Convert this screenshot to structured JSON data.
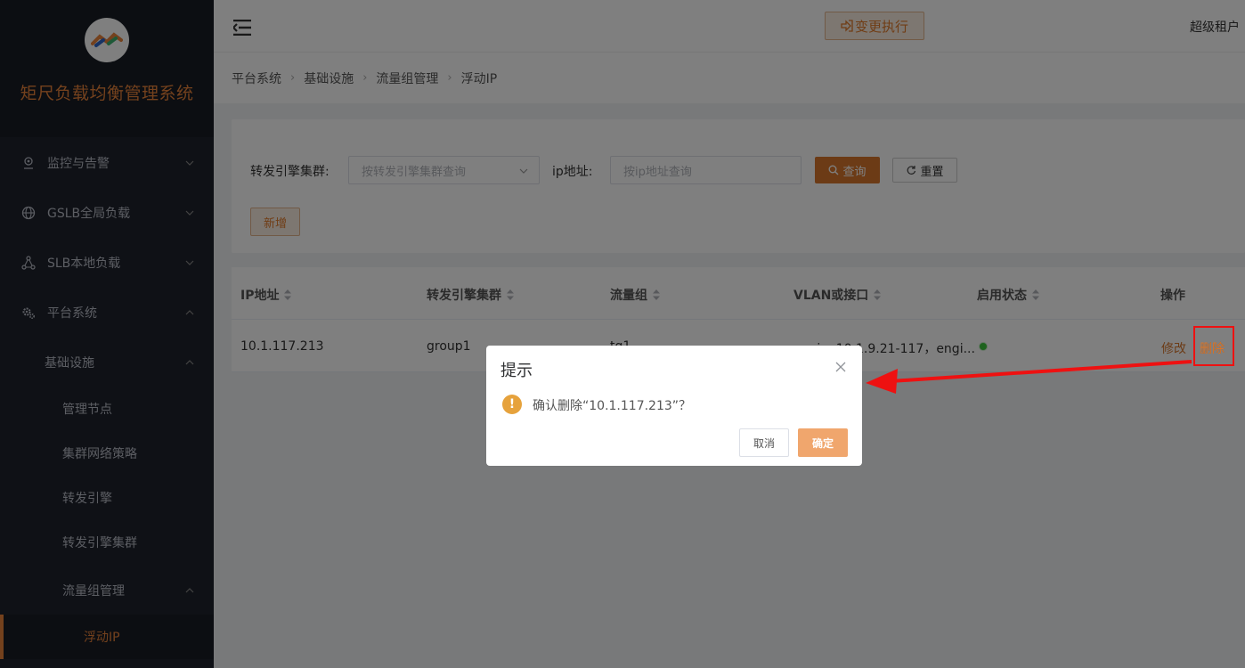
{
  "app": {
    "title": "矩尺负载均衡管理系统"
  },
  "sidebar": {
    "items": [
      {
        "label": "监控与告警",
        "icon": "location-pin-icon"
      },
      {
        "label": "GSLB全局负载",
        "icon": "globe-icon"
      },
      {
        "label": "SLB本地负载",
        "icon": "network-nodes-icon"
      },
      {
        "label": "平台系统",
        "icon": "gears-icon"
      }
    ],
    "sub_group": "基础设施",
    "sub_items": [
      "管理节点",
      "集群网络策略",
      "转发引擎",
      "转发引擎集群"
    ],
    "flow_group": "流量组管理",
    "active_item": "浮动IP"
  },
  "header": {
    "change_button": "变更执行",
    "user": "超级租户"
  },
  "breadcrumb": [
    "平台系统",
    "基础设施",
    "流量组管理",
    "浮动IP"
  ],
  "search": {
    "cluster_label": "转发引擎集群:",
    "cluster_placeholder": "按转发引擎集群查询",
    "ip_label": "ip地址:",
    "ip_placeholder": "按ip地址查询",
    "query_button": "查询",
    "reset_button": "重置",
    "add_button": "新增"
  },
  "table": {
    "columns": [
      "IP地址",
      "转发引擎集群",
      "流量组",
      "VLAN或接口",
      "启用状态",
      "操作"
    ],
    "rows": [
      {
        "ip": "10.1.117.213",
        "cluster": "group1",
        "flow_group": "tg1",
        "vlan": "engine10.1.9.21-117，engi...",
        "status": "enabled",
        "edit": "修改",
        "delete": "删除"
      }
    ]
  },
  "modal": {
    "title": "提示",
    "message": "确认删除“10.1.117.213”？",
    "cancel": "取消",
    "ok": "确定"
  },
  "colors": {
    "accent": "#d8762c",
    "sidebar_bg": "#1e222d",
    "status_green": "#3cc53c",
    "annotation_red": "#ee1111"
  }
}
